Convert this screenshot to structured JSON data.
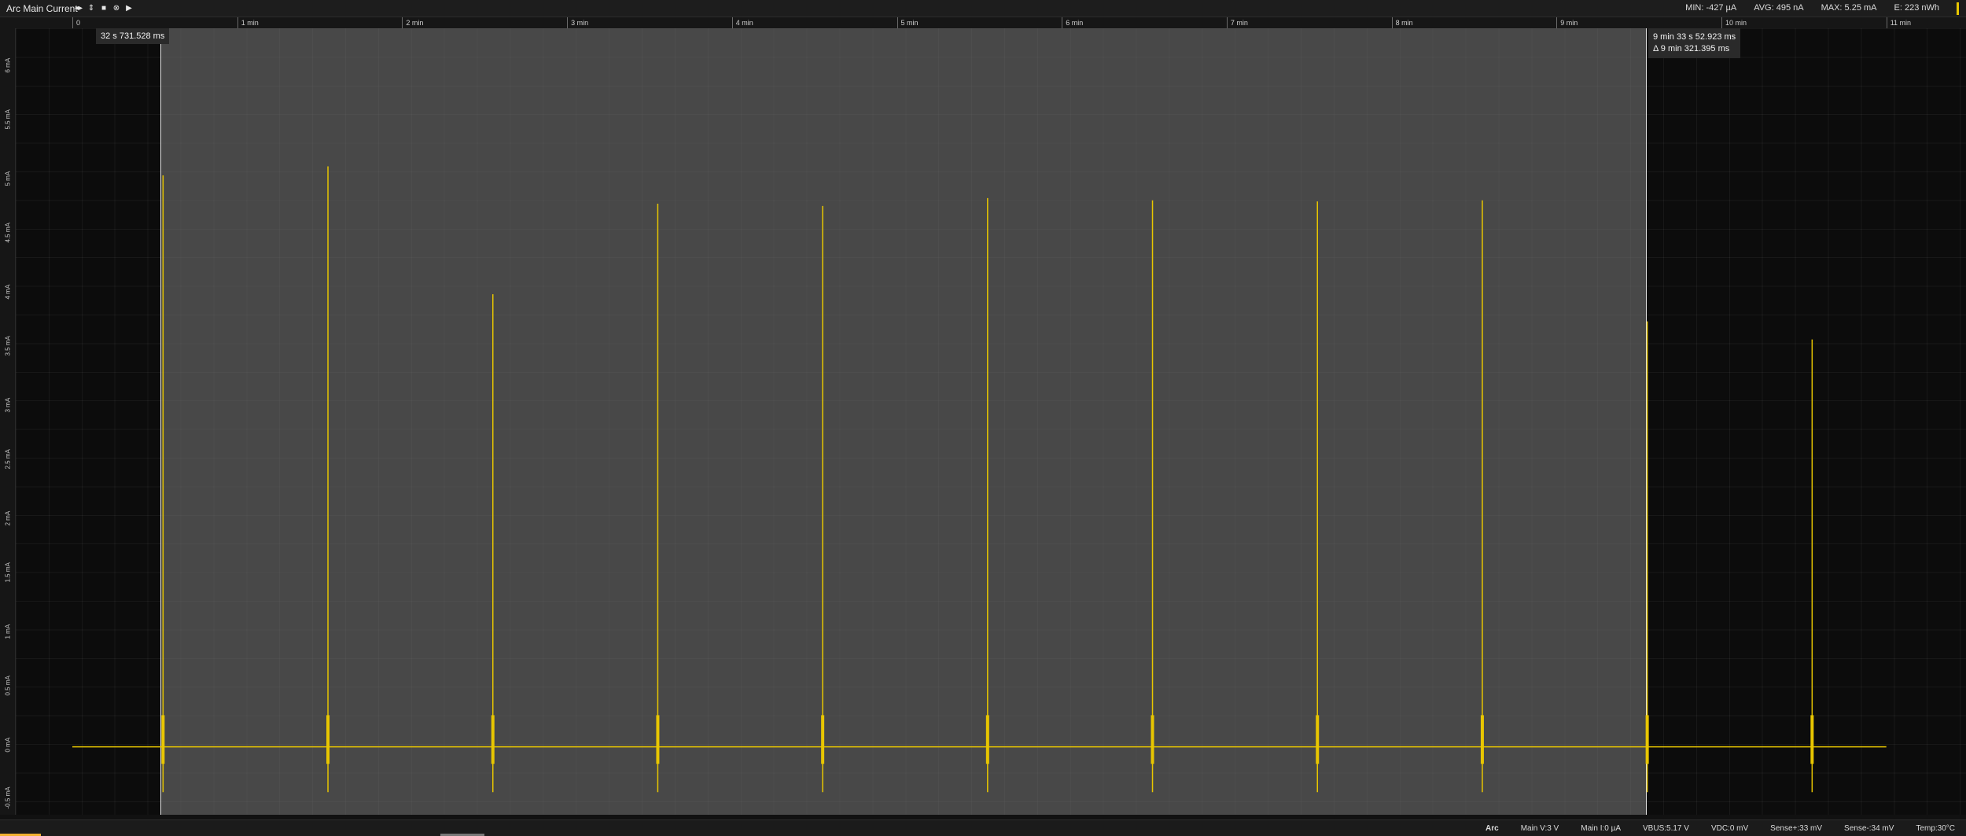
{
  "window": {
    "title": "Arc Main Current"
  },
  "toolbar": {
    "buttons": [
      {
        "name": "scroll-arrows-icon",
        "glyph": "◂▸"
      },
      {
        "name": "vertical-arrows-icon",
        "glyph": "⇕"
      },
      {
        "name": "stop-icon",
        "glyph": "■"
      },
      {
        "name": "close-icon",
        "glyph": "⊗"
      },
      {
        "name": "play-icon",
        "glyph": "▶"
      }
    ]
  },
  "stats": {
    "min": "MIN: -427 µA",
    "avg": "AVG: 495 nA",
    "max": "MAX: 5.25 mA",
    "energy": "E: 223 nWh"
  },
  "time_axis": {
    "labels": [
      "0",
      "1 min",
      "2 min",
      "3 min",
      "4 min",
      "5 min",
      "6 min",
      "7 min",
      "8 min",
      "9 min",
      "10 min",
      "11 min"
    ]
  },
  "y_axis": {
    "labels": [
      "6 mA",
      "5.5 mA",
      "5 mA",
      "4.5 mA",
      "4 mA",
      "3.5 mA",
      "3 mA",
      "2.5 mA",
      "2 mA",
      "1.5 mA",
      "1 mA",
      "0.5 mA",
      "0 mA",
      "-0.5 mA"
    ],
    "min": -0.6,
    "max": 6.35
  },
  "cursors": {
    "left_label": "32 s 731.528 ms",
    "right_time": "9 min 33 s 52.923 ms",
    "right_delta": "Δ 9 min 321.395 ms"
  },
  "chart_data": {
    "type": "line",
    "x_unit": "seconds",
    "y_unit": "mA",
    "baseline": 0,
    "spikes": [
      {
        "t": 33,
        "peak": 5.05
      },
      {
        "t": 93,
        "peak": 5.13
      },
      {
        "t": 153,
        "peak": 4.0
      },
      {
        "t": 213,
        "peak": 4.8
      },
      {
        "t": 273,
        "peak": 4.78
      },
      {
        "t": 333,
        "peak": 4.85
      },
      {
        "t": 393,
        "peak": 4.83
      },
      {
        "t": 453,
        "peak": 4.82
      },
      {
        "t": 513,
        "peak": 4.83
      },
      {
        "t": 573,
        "peak": 3.76
      },
      {
        "t": 633,
        "peak": 3.6
      }
    ],
    "color": "#e8c600"
  },
  "status": {
    "source": "Arc",
    "main_v": "Main V:3 V",
    "main_i": "Main I:0 µA",
    "vbus": "VBUS:5.17 V",
    "vdc": "VDC:0 mV",
    "sense_plus": "Sense+:33 mV",
    "sense_minus": "Sense-:34 mV",
    "temp": "Temp:30°C"
  }
}
